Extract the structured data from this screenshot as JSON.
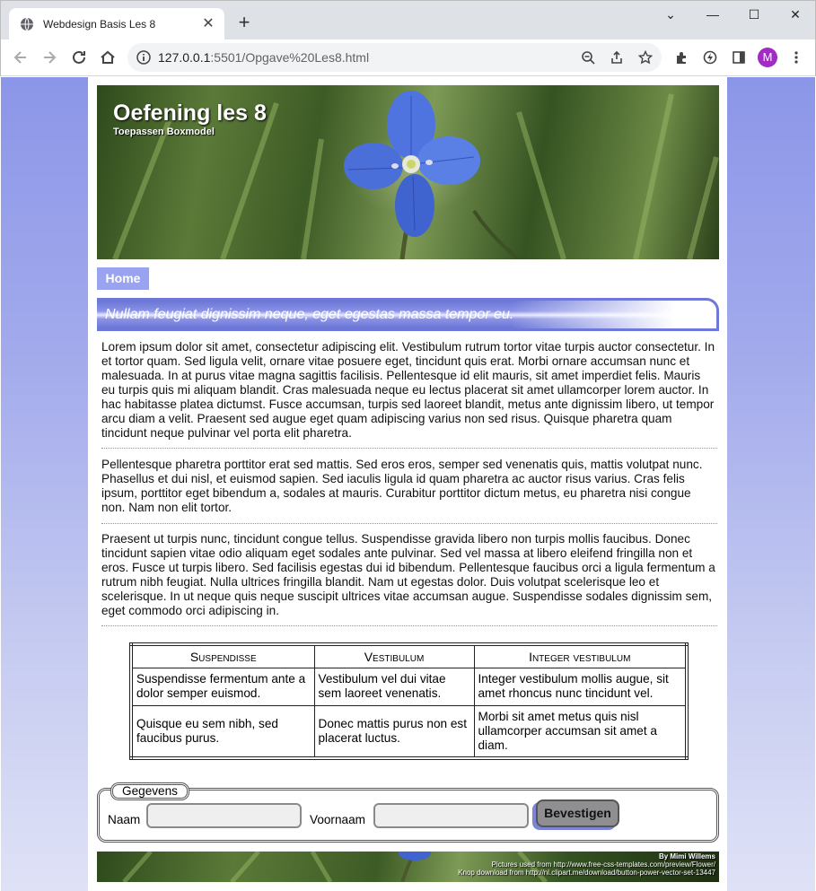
{
  "browser": {
    "tab_title": "Webdesign Basis Les 8",
    "url_host": "127.0.0.1",
    "url_rest": ":5501/Opgave%20Les8.html",
    "profile_initial": "M"
  },
  "header": {
    "title": "Oefening les 8",
    "subtitle": "Toepassen Boxmodel"
  },
  "nav": {
    "home": "Home"
  },
  "banner": "Nullam feugiat dignissim neque, eget egestas massa tempor eu.",
  "paragraphs": [
    "Lorem ipsum dolor sit amet, consectetur adipiscing elit. Vestibulum rutrum tortor vitae turpis auctor consectetur. In et tortor quam. Sed ligula velit, ornare vitae posuere eget, tincidunt quis erat. Morbi ornare accumsan nunc et malesuada. In at purus vitae magna sagittis facilisis. Pellentesque id elit mauris, sit amet imperdiet felis. Mauris eu turpis quis mi aliquam blandit. Cras malesuada neque eu lectus placerat sit amet ullamcorper lorem auctor. In hac habitasse platea dictumst. Fusce accumsan, turpis sed laoreet blandit, metus ante dignissim libero, ut tempor arcu diam a velit. Praesent sed augue eget quam adipiscing varius non sed risus. Quisque pharetra quam tincidunt neque pulvinar vel porta elit pharetra.",
    "Pellentesque pharetra porttitor erat sed mattis. Sed eros eros, semper sed venenatis quis, mattis volutpat nunc. Phasellus et dui nisl, et euismod sapien. Sed iaculis ligula id quam pharetra ac auctor risus varius. Cras felis ipsum, porttitor eget bibendum a, sodales at mauris. Curabitur porttitor dictum metus, eu pharetra nisi congue non. Nam non elit tortor.",
    "Praesent ut turpis nunc, tincidunt congue tellus. Suspendisse gravida libero non turpis mollis faucibus. Donec tincidunt sapien vitae odio aliquam eget sodales ante pulvinar. Sed vel massa at libero eleifend fringilla non et eros. Fusce ut turpis libero. Sed facilisis egestas dui id bibendum. Pellentesque faucibus orci a ligula fermentum a rutrum nibh feugiat. Nulla ultrices fringilla blandit. Nam ut egestas dolor. Duis volutpat scelerisque leo et scelerisque. In ut neque quis neque suscipit ultrices vitae accumsan augue. Suspendisse sodales dignissim sem, eget commodo orci adipiscing in."
  ],
  "table": {
    "headers": [
      "Suspendisse",
      "Vestibulum",
      "Integer vestibulum"
    ],
    "rows": [
      [
        "Suspendisse fermentum ante a dolor semper euismod.",
        "Vestibulum vel dui vitae sem laoreet venenatis.",
        "Integer vestibulum mollis augue, sit amet rhoncus nunc tincidunt vel."
      ],
      [
        "Quisque eu sem nibh, sed faucibus purus.",
        "Donec mattis purus non est placerat luctus.",
        "Morbi sit amet metus quis nisl ullamcorper accumsan sit amet a diam."
      ]
    ]
  },
  "form": {
    "legend": "Gegevens",
    "naam_label": "Naam",
    "naam_value": "",
    "voornaam_label": "Voornaam",
    "voornaam_value": "",
    "submit": "Bevestigen"
  },
  "footer": {
    "by": "By Mimi Willems",
    "pictures": "Pictures used from http://www.free-css-templates.com/preview/Flower/",
    "button_credit": "Knop download from http://nl.clipart.me/download/button-power-vector-set-13447"
  },
  "colors": {
    "accent": "#9aa3f0",
    "banner": "#6d78d8",
    "page_bg_top": "#8c96e8",
    "avatar": "#a12bc4"
  }
}
